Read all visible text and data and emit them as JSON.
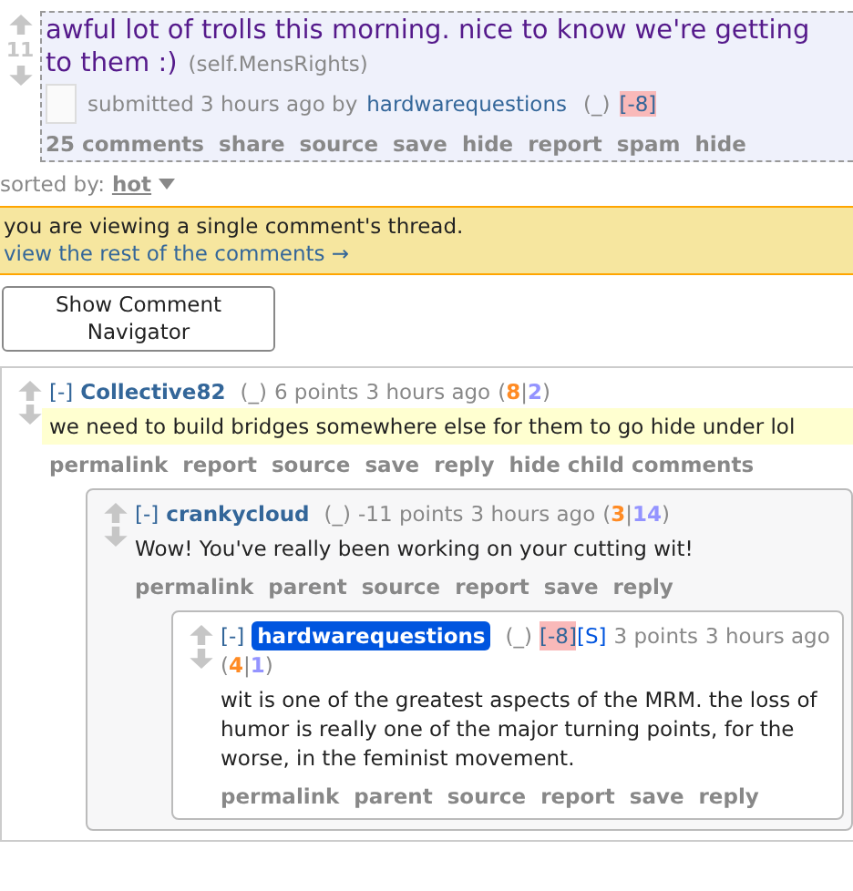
{
  "post": {
    "score": "11",
    "title": "awful lot of trolls this morning. nice to know we're getting to them :)",
    "domain": "(self.MensRights)",
    "tagline": {
      "prefix": "submitted 3 hours ago by",
      "author": "hardwarequestions",
      "flair": "(_)",
      "tag": "[-8]"
    },
    "buttons": [
      "25 comments",
      "share",
      "source",
      "save",
      "hide",
      "report",
      "spam",
      "hide"
    ]
  },
  "sort": {
    "label": "sorted by:",
    "value": "hot"
  },
  "notice": {
    "text": "you are viewing a single comment's thread.",
    "link": "view the rest of the comments →"
  },
  "navigator_button": "Show Comment Navigator",
  "comments": [
    {
      "collapse": "[-]",
      "author": "Collective82",
      "author_highlighted": false,
      "flair": "(_)",
      "points": "6 points",
      "time": "3 hours ago",
      "votes": [
        {
          "text": "(",
          "kind": "punct"
        },
        {
          "text": "8",
          "kind": "up"
        },
        {
          "text": "|",
          "kind": "punct"
        },
        {
          "text": "2",
          "kind": "down"
        },
        {
          "text": ")",
          "kind": "punct"
        }
      ],
      "body": "we need to build bridges somewhere else for them to go hide under lol",
      "body_highlighted": true,
      "buttons": [
        "permalink",
        "report",
        "source",
        "save",
        "reply",
        "hide child comments"
      ],
      "children": [
        {
          "collapse": "[-]",
          "author": "crankycloud",
          "author_highlighted": false,
          "flair": "(_)",
          "points": "-11 points",
          "time": "3 hours ago",
          "votes": [
            {
              "text": "(",
              "kind": "punct"
            },
            {
              "text": "3",
              "kind": "up"
            },
            {
              "text": "|",
              "kind": "punct"
            },
            {
              "text": "14",
              "kind": "down"
            },
            {
              "text": ")",
              "kind": "punct"
            }
          ],
          "body": "Wow! You've really been working on your cutting wit!",
          "body_highlighted": false,
          "buttons": [
            "permalink",
            "parent",
            "source",
            "report",
            "save",
            "reply"
          ],
          "children": [
            {
              "collapse": "[-]",
              "author": "hardwarequestions",
              "author_highlighted": true,
              "flair": "(_)",
              "tags": [
                {
                  "text": "[-8]",
                  "kind": "penalty"
                },
                {
                  "text": "[S]",
                  "kind": "submitter"
                }
              ],
              "points": "3 points",
              "time": "3 hours ago",
              "votes": [
                {
                  "text": "(",
                  "kind": "punct"
                },
                {
                  "text": "4",
                  "kind": "up"
                },
                {
                  "text": "|",
                  "kind": "punct"
                },
                {
                  "text": "1",
                  "kind": "down"
                },
                {
                  "text": ")",
                  "kind": "punct"
                }
              ],
              "body": "wit is one of the greatest aspects of the MRM. the loss of humor is really one of the major turning points, for the worse, in the feminist movement.",
              "body_highlighted": false,
              "buttons": [
                "permalink",
                "parent",
                "source",
                "report",
                "save",
                "reply"
              ]
            }
          ]
        }
      ]
    }
  ]
}
